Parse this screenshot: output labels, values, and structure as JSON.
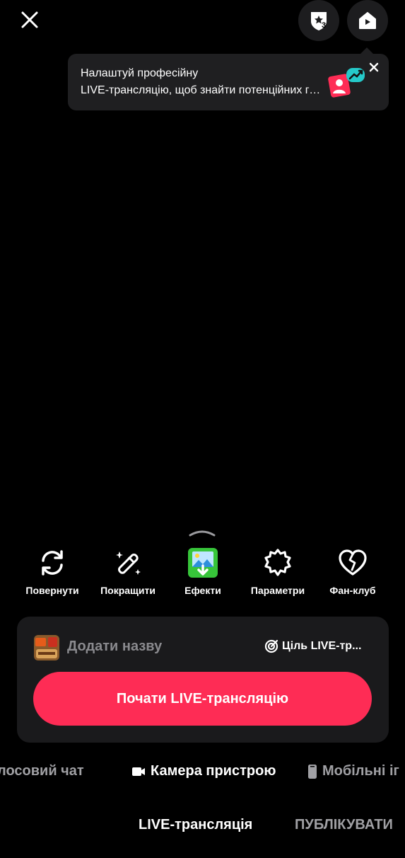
{
  "header": {
    "badge_count": "3"
  },
  "tooltip": {
    "line1": "Налаштуй професійну",
    "line2": "LIVE-трансляцію, щоб знайти потенційних глядачів"
  },
  "tools": [
    {
      "label": "Повернути",
      "icon": "rotate-icon"
    },
    {
      "label": "Покращити",
      "icon": "magic-wand-icon"
    },
    {
      "label": "Ефекти",
      "icon": "effects-image-icon"
    },
    {
      "label": "Параметри",
      "icon": "settings-gear-icon"
    },
    {
      "label": "Фан-клуб",
      "icon": "heart-icon"
    }
  ],
  "panel": {
    "add_title": "Додати назву",
    "goal_label": "Ціль LIVE-тр...",
    "start_button": "Почати LIVE-трансляцію"
  },
  "modes": {
    "voice": "лосовий чат",
    "camera": "Камера пристрою",
    "mobile": "Мобільні іг"
  },
  "tabs": {
    "live": "LIVE-трансляція",
    "post": "ПУБЛІКУВАТИ"
  },
  "colors": {
    "accent": "#fe2c55",
    "effects_green": "#37c53a",
    "panel_bg": "#1a1a1c"
  }
}
